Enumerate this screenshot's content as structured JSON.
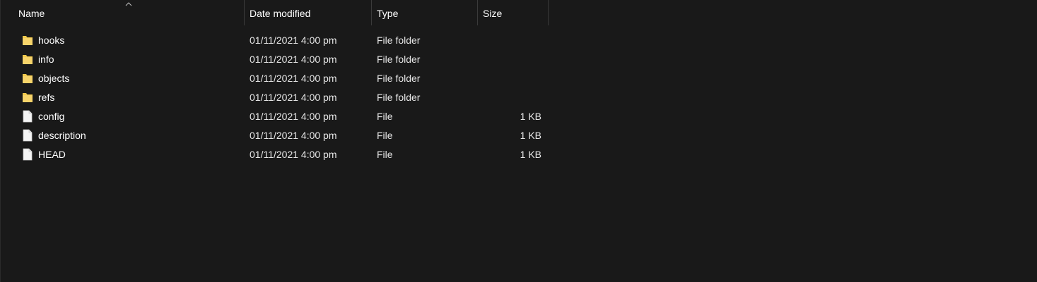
{
  "columns": {
    "name": "Name",
    "date": "Date modified",
    "type": "Type",
    "size": "Size"
  },
  "sort": {
    "column": "name",
    "direction": "ascending",
    "icon": "chevron-up-icon"
  },
  "items": [
    {
      "name": "hooks",
      "date": "01/11/2021 4:00 pm",
      "type": "File folder",
      "size": "",
      "icon": "folder-icon"
    },
    {
      "name": "info",
      "date": "01/11/2021 4:00 pm",
      "type": "File folder",
      "size": "",
      "icon": "folder-icon"
    },
    {
      "name": "objects",
      "date": "01/11/2021 4:00 pm",
      "type": "File folder",
      "size": "",
      "icon": "folder-icon"
    },
    {
      "name": "refs",
      "date": "01/11/2021 4:00 pm",
      "type": "File folder",
      "size": "",
      "icon": "folder-icon"
    },
    {
      "name": "config",
      "date": "01/11/2021 4:00 pm",
      "type": "File",
      "size": "1 KB",
      "icon": "file-icon"
    },
    {
      "name": "description",
      "date": "01/11/2021 4:00 pm",
      "type": "File",
      "size": "1 KB",
      "icon": "file-icon"
    },
    {
      "name": "HEAD",
      "date": "01/11/2021 4:00 pm",
      "type": "File",
      "size": "1 KB",
      "icon": "file-icon"
    }
  ],
  "colors": {
    "background": "#191919",
    "text": "#ffffff",
    "folder": "#f2c94c",
    "file": "#f4f4f4"
  }
}
